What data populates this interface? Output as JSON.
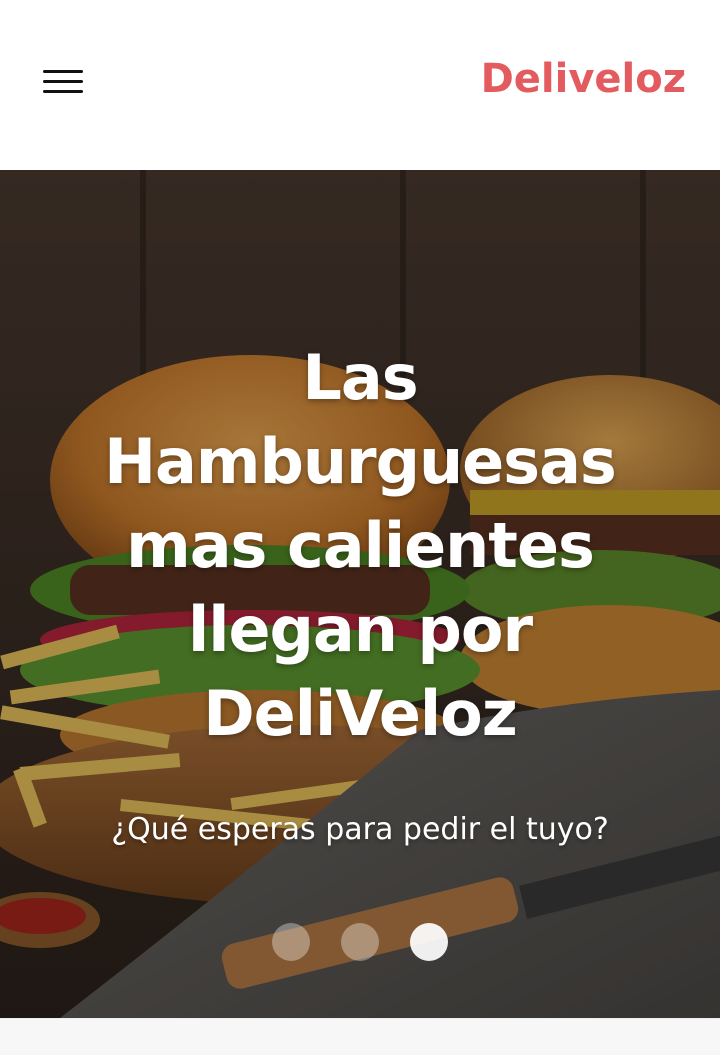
{
  "header": {
    "menu_icon": "hamburger-menu-icon",
    "brand": "Deliveloz",
    "brand_color": "#e35b5f"
  },
  "hero": {
    "title_lines": [
      "Las",
      "Hamburguesas",
      "mas calientes",
      "llegan por",
      "DeliVeloz"
    ],
    "subtitle": "¿Qué esperas para pedir el tuyo?",
    "background_image": "burgers-and-fries-photo",
    "slides": 3,
    "active_slide": 3
  }
}
